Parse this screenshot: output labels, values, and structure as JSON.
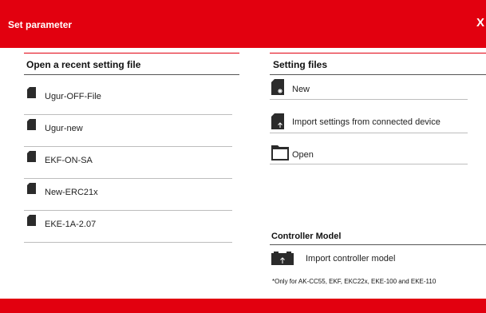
{
  "window": {
    "title": "Set parameter",
    "close_label": "X"
  },
  "recent": {
    "heading": "Open a recent setting file",
    "items": [
      {
        "label": "Ugur-OFF-File",
        "icon": "file-icon"
      },
      {
        "label": "Ugur-new",
        "icon": "file-icon"
      },
      {
        "label": "EKF-ON-SA",
        "icon": "file-icon"
      },
      {
        "label": "New-ERC21x",
        "icon": "file-icon"
      },
      {
        "label": "EKE-1A-2.07",
        "icon": "file-icon"
      }
    ]
  },
  "settings": {
    "heading": "Setting files",
    "new_label": "New",
    "import_label": "Import settings from connected device",
    "open_label": "Open"
  },
  "controller": {
    "heading": "Controller Model",
    "import_label": "Import controller model",
    "note": "*Only for AK-CC55, EKF, EKC22x, EKE-100 and EKE-110"
  },
  "colors": {
    "accent": "#e2000f",
    "icon": "#2b2b2b"
  }
}
